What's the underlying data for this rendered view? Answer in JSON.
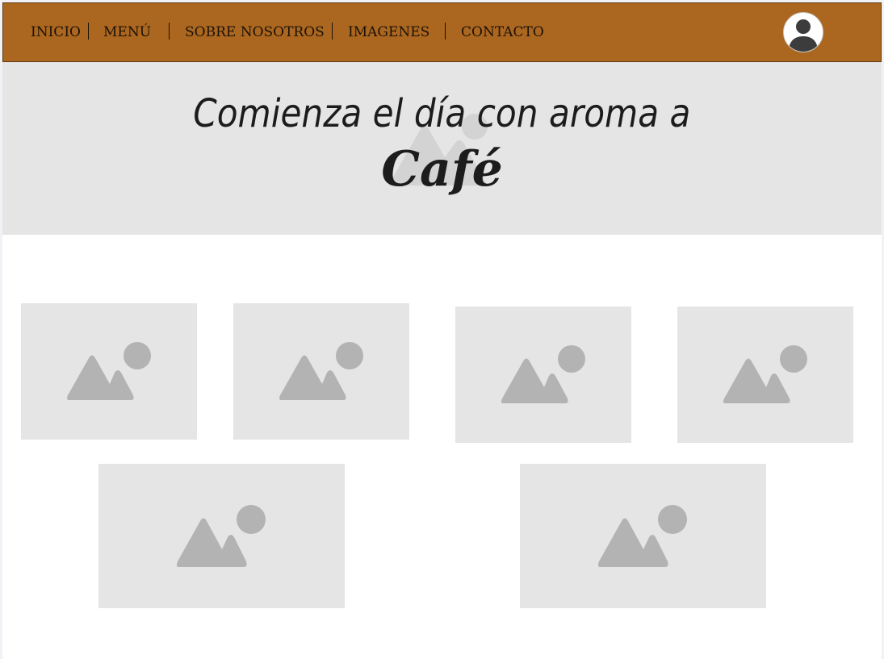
{
  "nav": {
    "items": [
      {
        "label": "INICIO"
      },
      {
        "label": "MENÚ"
      },
      {
        "label": "SOBRE NOSOTROS"
      },
      {
        "label": "IMAGENES"
      },
      {
        "label": "CONTACTO"
      }
    ],
    "avatar_icon": "user-avatar-icon"
  },
  "hero": {
    "line1": "Comienza el día con aroma a",
    "line2": "Café",
    "background_icon": "image-placeholder-icon"
  },
  "gallery": {
    "placeholder_icon": "image-placeholder-icon",
    "image_count": 6
  },
  "colors": {
    "navbar": "#ab671f",
    "hero_bg": "#e5e5e5",
    "placeholder_bg": "#e5e5e5",
    "placeholder_icon": "#b3b3b3",
    "text": "#1e1208"
  }
}
